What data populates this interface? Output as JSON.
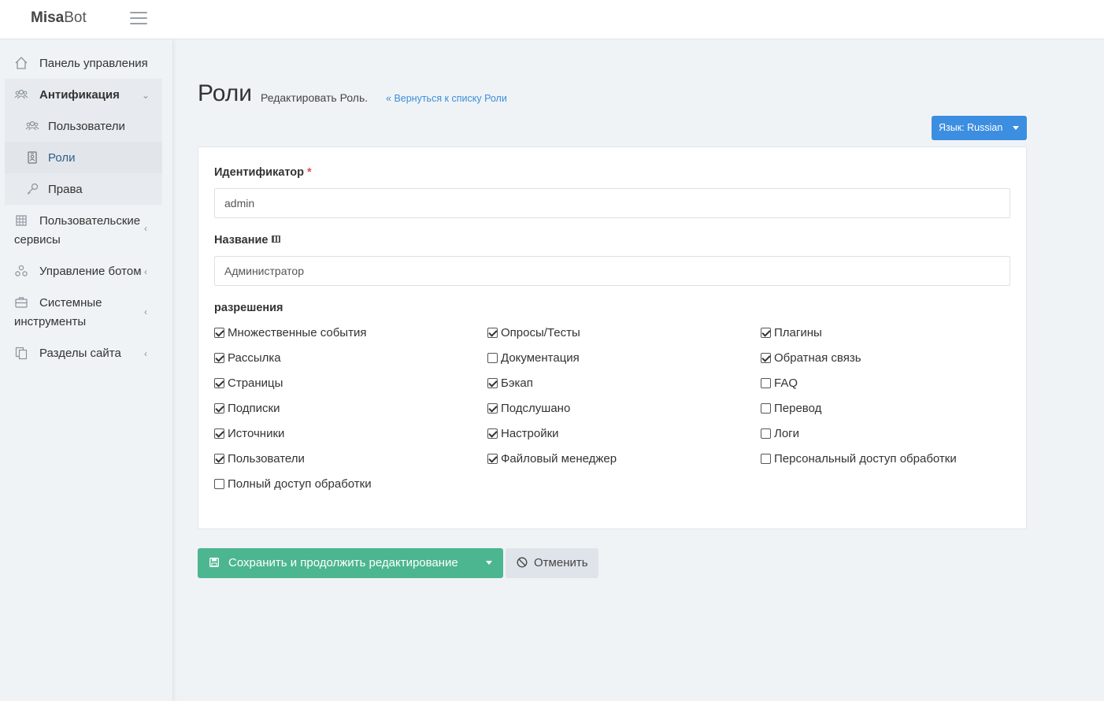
{
  "brand": {
    "strong": "Misa",
    "light": "Bot"
  },
  "sidebar": {
    "items": [
      {
        "label": "Панель управления",
        "icon": "home-icon"
      },
      {
        "label": "Антификация",
        "icon": "users-icon"
      },
      {
        "label": "Пользователи",
        "icon": "users-icon"
      },
      {
        "label": "Роли",
        "icon": "id-badge-icon"
      },
      {
        "label": "Права",
        "icon": "key-icon"
      },
      {
        "label": "Пользовательские сервисы",
        "icon": "grid-icon"
      },
      {
        "label": "Управление ботом",
        "icon": "cogs-icon"
      },
      {
        "label": "Системные инструменты",
        "icon": "toolbox-icon"
      },
      {
        "label": "Разделы сайта",
        "icon": "copy-icon"
      }
    ]
  },
  "header": {
    "title": "Роли",
    "subtitle": "Редактировать Роль.",
    "back_link": "Вернуться к списку Роли",
    "language_button": "Язык: Russian"
  },
  "form": {
    "identifier_label": "Идентификатор",
    "identifier_required": "*",
    "identifier_value": "admin",
    "name_label": "Название",
    "name_value": "Администратор",
    "permissions_label": "разрешения",
    "permissions": [
      {
        "label": "Множественные события",
        "checked": true
      },
      {
        "label": "Опросы/Тесты",
        "checked": true
      },
      {
        "label": "Плагины",
        "checked": true
      },
      {
        "label": "Рассылка",
        "checked": true
      },
      {
        "label": "Документация",
        "checked": false
      },
      {
        "label": "Обратная связь",
        "checked": true
      },
      {
        "label": "Страницы",
        "checked": true
      },
      {
        "label": "Бэкап",
        "checked": true
      },
      {
        "label": "FAQ",
        "checked": false
      },
      {
        "label": "Подписки",
        "checked": true
      },
      {
        "label": "Подслушано",
        "checked": true
      },
      {
        "label": "Перевод",
        "checked": false
      },
      {
        "label": "Источники",
        "checked": true
      },
      {
        "label": "Настройки",
        "checked": true
      },
      {
        "label": "Логи",
        "checked": false
      },
      {
        "label": "Пользователи",
        "checked": true
      },
      {
        "label": "Файловый менеджер",
        "checked": true
      },
      {
        "label": "Персональный доступ обработки",
        "checked": false
      },
      {
        "label": "Полный доступ обработки",
        "checked": false
      }
    ]
  },
  "actions": {
    "save_label": "Сохранить и продолжить редактирование",
    "cancel_label": "Отменить"
  },
  "colors": {
    "accent": "#3c8ee0",
    "save": "#4bb68f",
    "cancel": "#dfe4ea"
  }
}
